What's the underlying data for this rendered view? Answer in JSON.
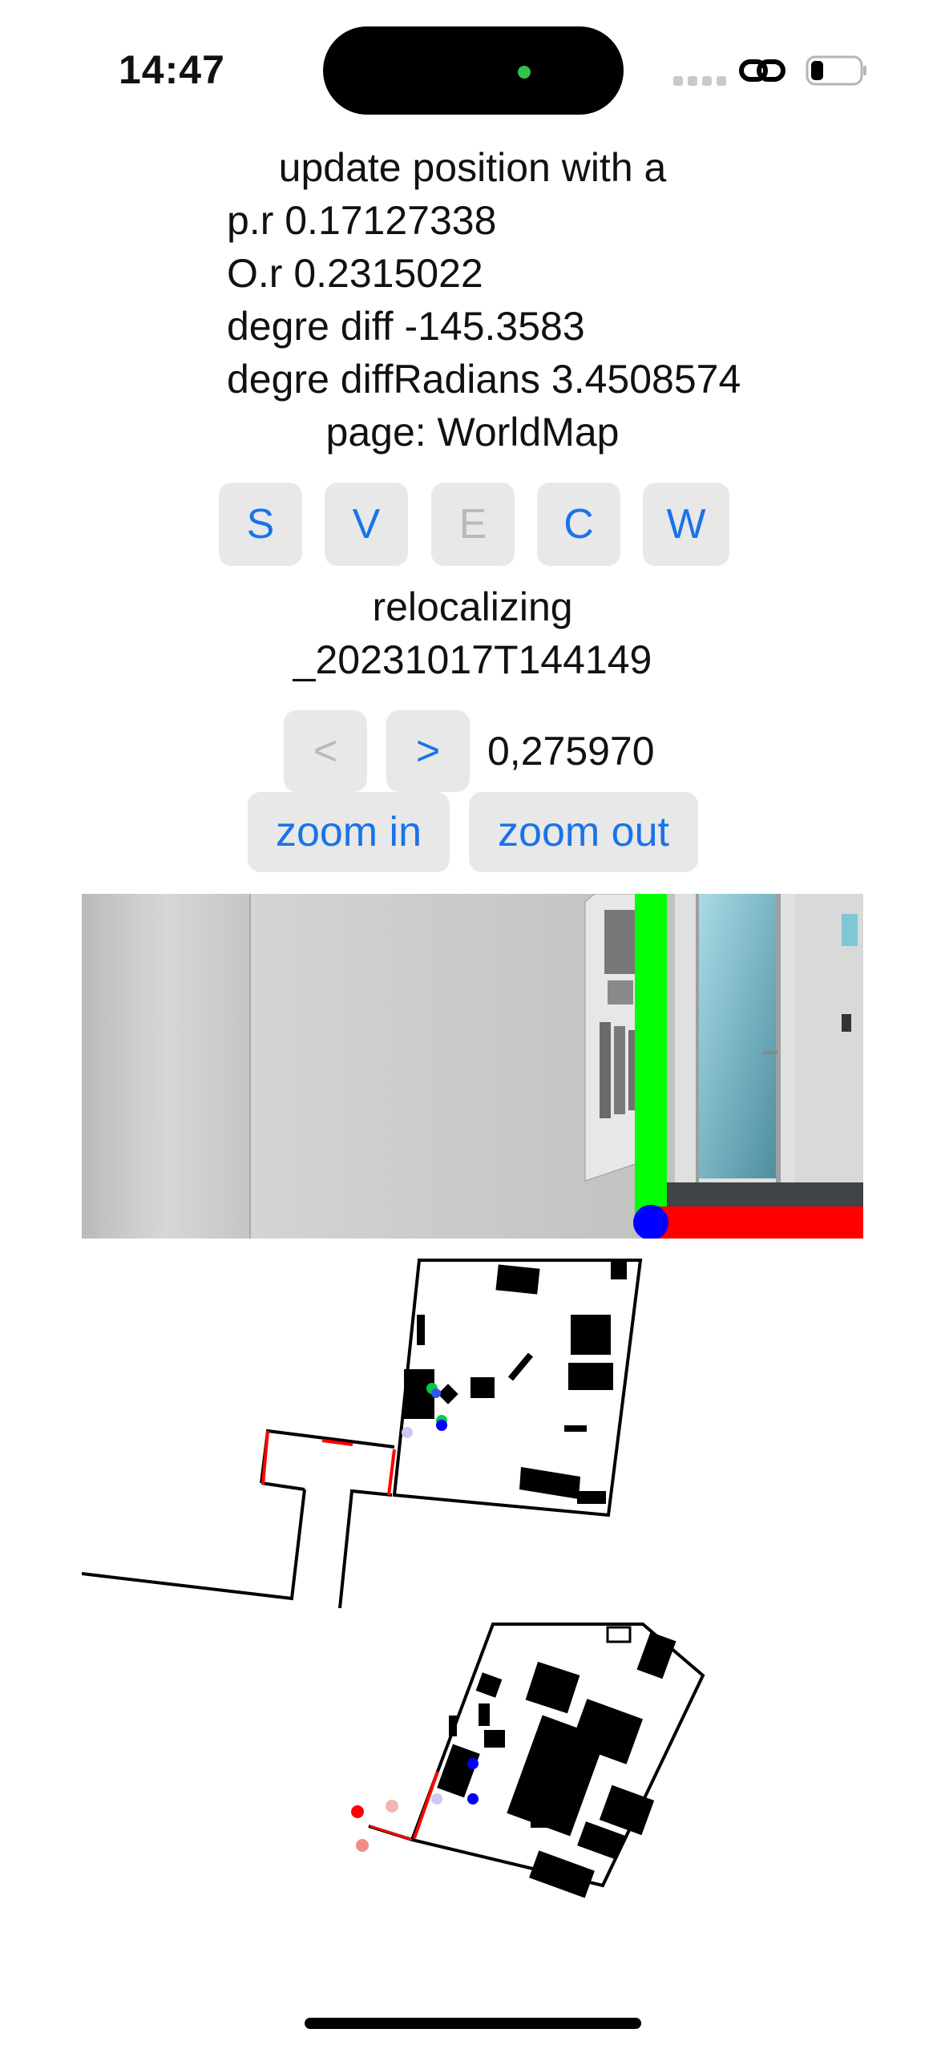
{
  "status_bar": {
    "time": "14:47",
    "icons": [
      "cellular-dots-icon",
      "link-icon",
      "battery-icon"
    ]
  },
  "info": {
    "title": "update position with a",
    "pr": "p.r 0.17127338",
    "or": "O.r 0.2315022",
    "degre_diff": "degre diff -145.3583",
    "degre_diff_radians": "degre diffRadians 3.4508574",
    "page": "page: WorldMap"
  },
  "mode_buttons": [
    {
      "label": "S",
      "enabled": true
    },
    {
      "label": "V",
      "enabled": true
    },
    {
      "label": "E",
      "enabled": false
    },
    {
      "label": "C",
      "enabled": true
    },
    {
      "label": "W",
      "enabled": true
    }
  ],
  "relocalizing": {
    "line1": "relocalizing",
    "line2": "_20231017T144149"
  },
  "nav": {
    "prev_label": "<",
    "next_label": ">",
    "coords": "0,275970"
  },
  "zoom": {
    "zoom_in": "zoom in",
    "zoom_out": "zoom out"
  },
  "colors": {
    "accent": "#1a73e8",
    "button_bg": "#e8e8e8",
    "axis_x": "#ff0000",
    "axis_y": "#00ff00",
    "axis_z": "#0000ff"
  }
}
